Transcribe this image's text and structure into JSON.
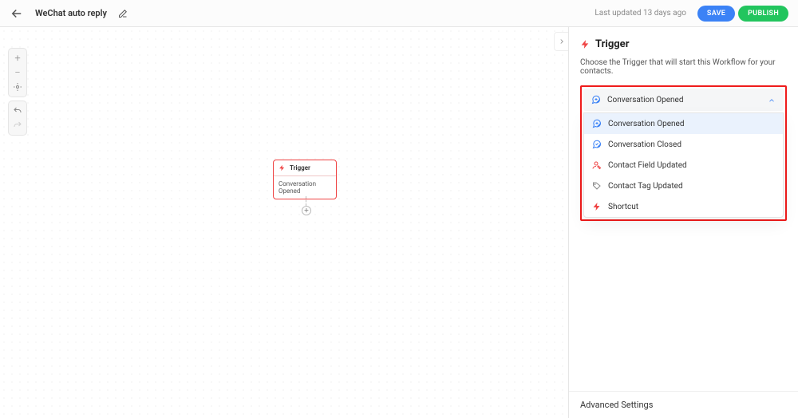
{
  "header": {
    "title": "WeChat auto reply",
    "updated": "Last updated 13 days ago",
    "save": "SAVE",
    "publish": "PUBLISH"
  },
  "trigger_card": {
    "label": "Trigger",
    "value": "Conversation Opened"
  },
  "panel": {
    "title": "Trigger",
    "desc": "Choose the Trigger that will start this Workflow for your contacts.",
    "selected": "Conversation Opened",
    "options": [
      {
        "label": "Conversation Opened",
        "icon": "chat-plus",
        "color": "blue",
        "selected": true
      },
      {
        "label": "Conversation Closed",
        "icon": "chat-check",
        "color": "blue",
        "selected": false
      },
      {
        "label": "Contact Field Updated",
        "icon": "person-edit",
        "color": "red",
        "selected": false
      },
      {
        "label": "Contact Tag Updated",
        "icon": "tag",
        "color": "gray",
        "selected": false
      },
      {
        "label": "Shortcut",
        "icon": "bolt",
        "color": "red",
        "selected": false
      }
    ],
    "footer": "Advanced Settings"
  }
}
